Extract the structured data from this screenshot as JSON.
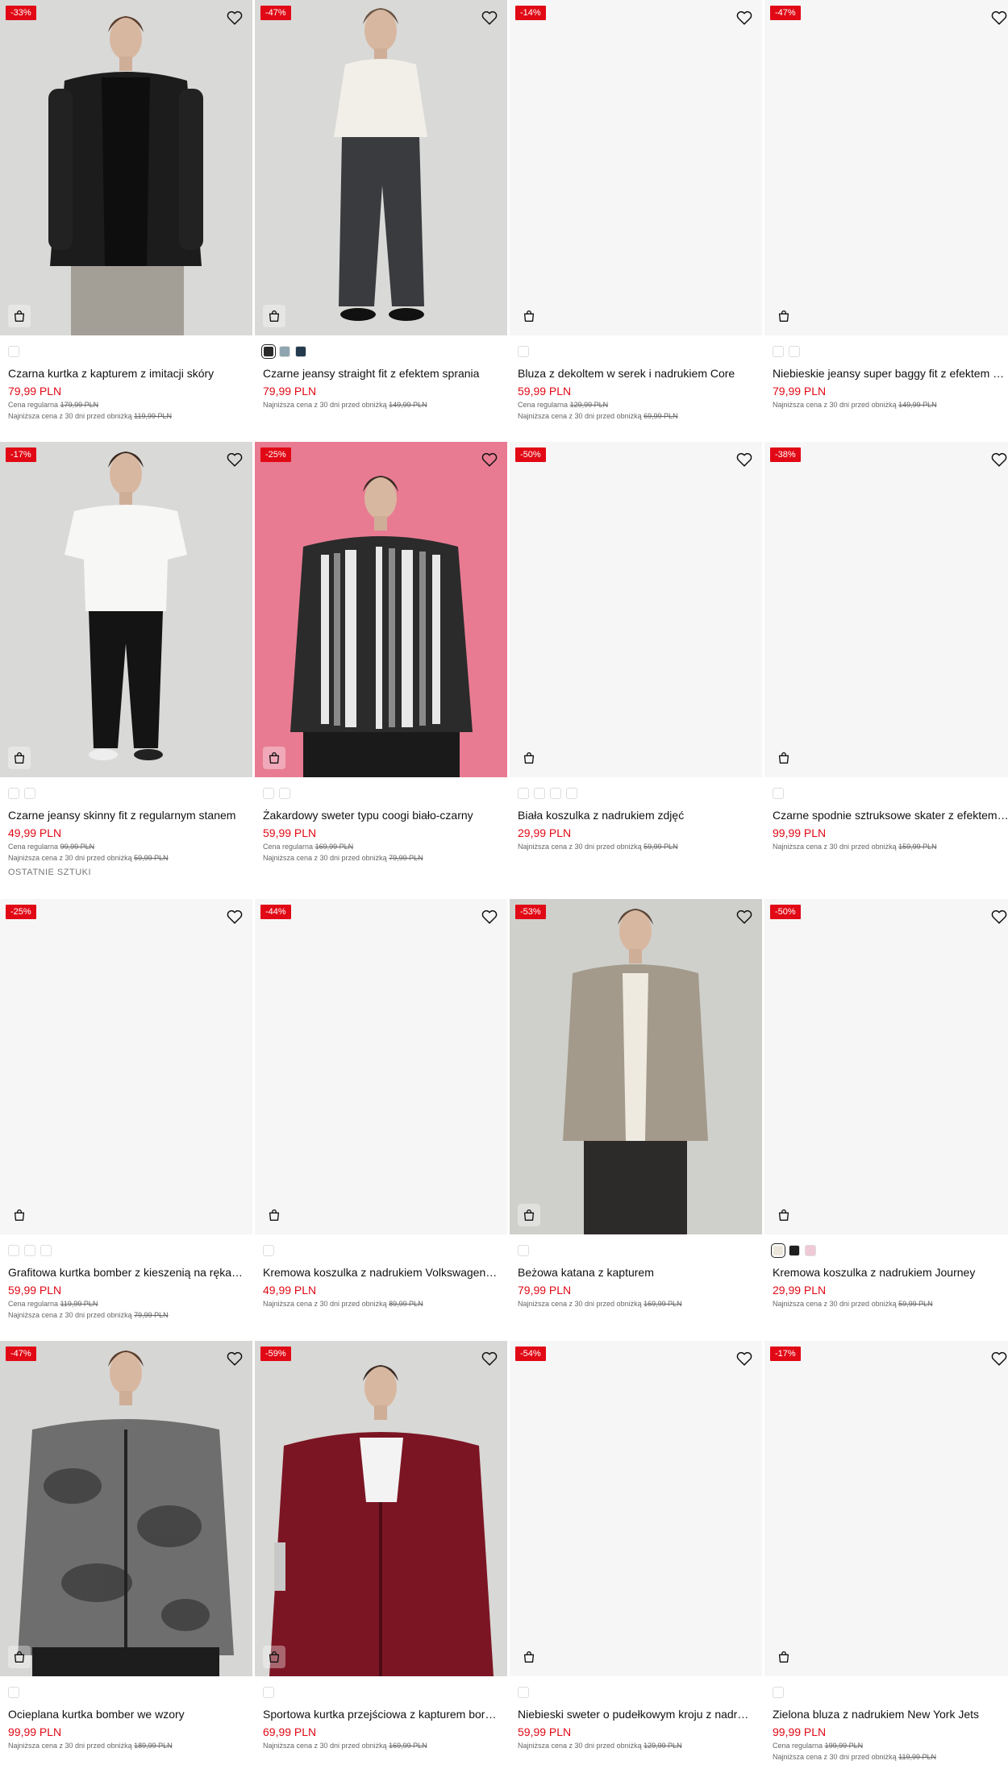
{
  "colors": {
    "accent": "#e10915",
    "badge_bg": "#e10915",
    "text": "#111111",
    "muted": "#666666"
  },
  "icons": {
    "favorite": "heart-icon",
    "add_to_cart": "shopping-bag-icon"
  },
  "products": [
    {
      "discount": "-33%",
      "name": "Czarna kurtka z kapturem z imitacji skóry",
      "price": "79,99 PLN",
      "regular_label": "Cena regularna",
      "regular_price": "179,99 PLN",
      "lowest_label": "Najniższa cena z 30 dni przed obniżką",
      "lowest_price": "119,99 PLN",
      "swatches": [
        "#ffffff"
      ],
      "tag": ""
    },
    {
      "discount": "-47%",
      "name": "Czarne jeansy straight fit z efektem sprania",
      "price": "79,99 PLN",
      "regular_label": "",
      "regular_price": "",
      "lowest_label": "Najniższa cena z 30 dni przed obniżką",
      "lowest_price": "149,99 PLN",
      "swatches": [
        "#2a2a2a",
        "#8fa6b0",
        "#243a4e"
      ],
      "tag": ""
    },
    {
      "discount": "-14%",
      "name": "Bluza z dekoltem w serek i nadrukiem Core",
      "price": "59,99 PLN",
      "regular_label": "Cena regularna",
      "regular_price": "129,99 PLN",
      "lowest_label": "Najniższa cena z 30 dni przed obniżką",
      "lowest_price": "69,99 PLN",
      "swatches": [
        "#ffffff"
      ],
      "tag": ""
    },
    {
      "discount": "-47%",
      "name": "Niebieskie jeansy super baggy fit z efektem sprania",
      "price": "79,99 PLN",
      "regular_label": "",
      "regular_price": "",
      "lowest_label": "Najniższa cena z 30 dni przed obniżką",
      "lowest_price": "149,99 PLN",
      "swatches": [
        "#ffffff",
        "#ffffff"
      ],
      "tag": ""
    },
    {
      "discount": "-17%",
      "name": "Czarne jeansy skinny fit z regularnym stanem",
      "price": "49,99 PLN",
      "regular_label": "Cena regularna",
      "regular_price": "99,99 PLN",
      "lowest_label": "Najniższa cena z 30 dni przed obniżką",
      "lowest_price": "59,99 PLN",
      "swatches": [
        "#ffffff",
        "#ffffff"
      ],
      "tag": "OSTATNIE SZTUKI"
    },
    {
      "discount": "-25%",
      "name": "Żakardowy sweter typu coogi biało-czarny",
      "price": "59,99 PLN",
      "regular_label": "Cena regularna",
      "regular_price": "169,99 PLN",
      "lowest_label": "Najniższa cena z 30 dni przed obniżką",
      "lowest_price": "79,99 PLN",
      "swatches": [
        "#ffffff",
        "#ffffff"
      ],
      "tag": ""
    },
    {
      "discount": "-50%",
      "name": "Biała koszulka z nadrukiem zdjęć",
      "price": "29,99 PLN",
      "regular_label": "",
      "regular_price": "",
      "lowest_label": "Najniższa cena z 30 dni przed obniżką",
      "lowest_price": "59,99 PLN",
      "swatches": [
        "#ffffff",
        "#ffffff",
        "#ffffff",
        "#ffffff"
      ],
      "tag": ""
    },
    {
      "discount": "-38%",
      "name": "Czarne spodnie sztruksowe skater z efektem sprania",
      "price": "99,99 PLN",
      "regular_label": "",
      "regular_price": "",
      "lowest_label": "Najniższa cena z 30 dni przed obniżką",
      "lowest_price": "159,99 PLN",
      "swatches": [
        "#ffffff"
      ],
      "tag": ""
    },
    {
      "discount": "-25%",
      "name": "Grafitowa kurtka bomber z kieszenią na rękawie",
      "price": "59,99 PLN",
      "regular_label": "Cena regularna",
      "regular_price": "119,99 PLN",
      "lowest_label": "Najniższa cena z 30 dni przed obniżką",
      "lowest_price": "79,99 PLN",
      "swatches": [
        "#ffffff",
        "#ffffff",
        "#ffffff"
      ],
      "tag": ""
    },
    {
      "discount": "-44%",
      "name": "Kremowa koszulka z nadrukiem Volkswagen Beetle",
      "price": "49,99 PLN",
      "regular_label": "",
      "regular_price": "",
      "lowest_label": "Najniższa cena z 30 dni przed obniżką",
      "lowest_price": "89,99 PLN",
      "swatches": [
        "#ffffff"
      ],
      "tag": ""
    },
    {
      "discount": "-53%",
      "name": "Beżowa katana z kapturem",
      "price": "79,99 PLN",
      "regular_label": "",
      "regular_price": "",
      "lowest_label": "Najniższa cena z 30 dni przed obniżką",
      "lowest_price": "169,99 PLN",
      "swatches": [
        "#ffffff"
      ],
      "tag": ""
    },
    {
      "discount": "-50%",
      "name": "Kremowa koszulka z nadrukiem Journey",
      "price": "29,99 PLN",
      "regular_label": "",
      "regular_price": "",
      "lowest_label": "Najniższa cena z 30 dni przed obniżką",
      "lowest_price": "59,99 PLN",
      "swatches": [
        "#ece6da",
        "#1f1f1f",
        "#efc9d6"
      ],
      "tag": ""
    },
    {
      "discount": "-47%",
      "name": "Ocieplana kurtka bomber we wzory",
      "price": "99,99 PLN",
      "regular_label": "",
      "regular_price": "",
      "lowest_label": "Najniższa cena z 30 dni przed obniżką",
      "lowest_price": "189,99 PLN",
      "swatches": [
        "#ffffff"
      ],
      "tag": ""
    },
    {
      "discount": "-59%",
      "name": "Sportowa kurtka przejściowa z kapturem bordowa",
      "price": "69,99 PLN",
      "regular_label": "",
      "regular_price": "",
      "lowest_label": "Najniższa cena z 30 dni przed obniżką",
      "lowest_price": "169,99 PLN",
      "swatches": [
        "#ffffff"
      ],
      "tag": ""
    },
    {
      "discount": "-54%",
      "name": "Niebieski sweter o pudełkowym kroju z nadrukiem",
      "price": "59,99 PLN",
      "regular_label": "",
      "regular_price": "",
      "lowest_label": "Najniższa cena z 30 dni przed obniżką",
      "lowest_price": "129,99 PLN",
      "swatches": [
        "#ffffff"
      ],
      "tag": ""
    },
    {
      "discount": "-17%",
      "name": "Zielona bluza z nadrukiem New York Jets",
      "price": "99,99 PLN",
      "regular_label": "Cena regularna",
      "regular_price": "199,99 PLN",
      "lowest_label": "Najniższa cena z 30 dni przed obniżką",
      "lowest_price": "119,99 PLN",
      "swatches": [
        "#ffffff"
      ],
      "tag": ""
    }
  ]
}
